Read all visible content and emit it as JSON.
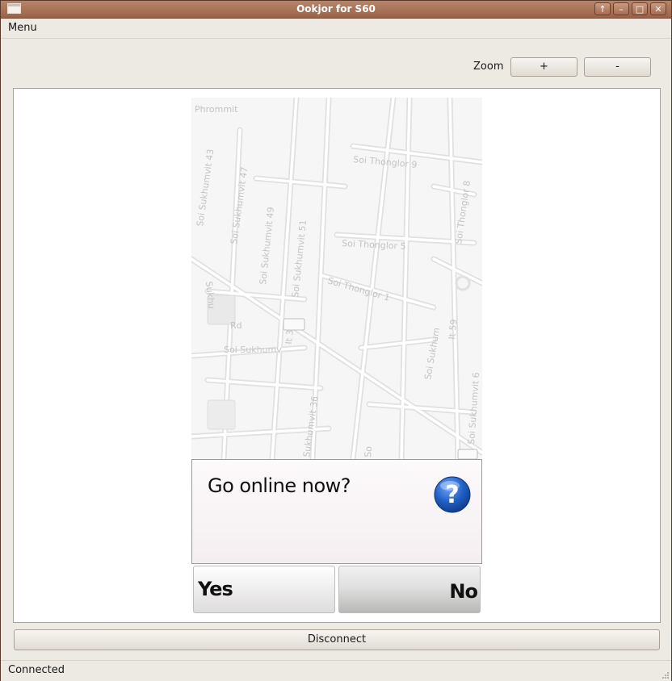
{
  "window": {
    "title": "Ookjor for S60",
    "controls": [
      "↑",
      "–",
      "□",
      "✕"
    ]
  },
  "menubar": {
    "menu_label": "Menu"
  },
  "toolbar": {
    "zoom_label": "Zoom",
    "zoom_in_label": "+",
    "zoom_out_label": "-"
  },
  "map": {
    "street_labels": [
      "Phrommit",
      "Soi Sukhumvit 43",
      "Soi Sukhumvit 47",
      "Soi Thonglor 9",
      "Soi Thonglor 8",
      "Soi Sukhumvit 49",
      "Soi Sukhumvit 51",
      "Soi Thonglor 5",
      "Soi Thonglor 1",
      "Sukhu",
      "Rd",
      "Soi Sukhumv",
      "It 3",
      "Soi Sukhum",
      "It 59",
      "Sukhumvit 36",
      "Soi Sukhumvit 6",
      "So"
    ]
  },
  "dialog": {
    "question": "Go online now?",
    "icon": "question-icon",
    "yes_label": "Yes",
    "no_label": "No"
  },
  "actions": {
    "disconnect_label": "Disconnect"
  },
  "status": {
    "text": "Connected"
  },
  "colors": {
    "titlebar": "#a66c50",
    "window_bg": "#ede9e3",
    "question_icon": "#1f5fc4"
  }
}
